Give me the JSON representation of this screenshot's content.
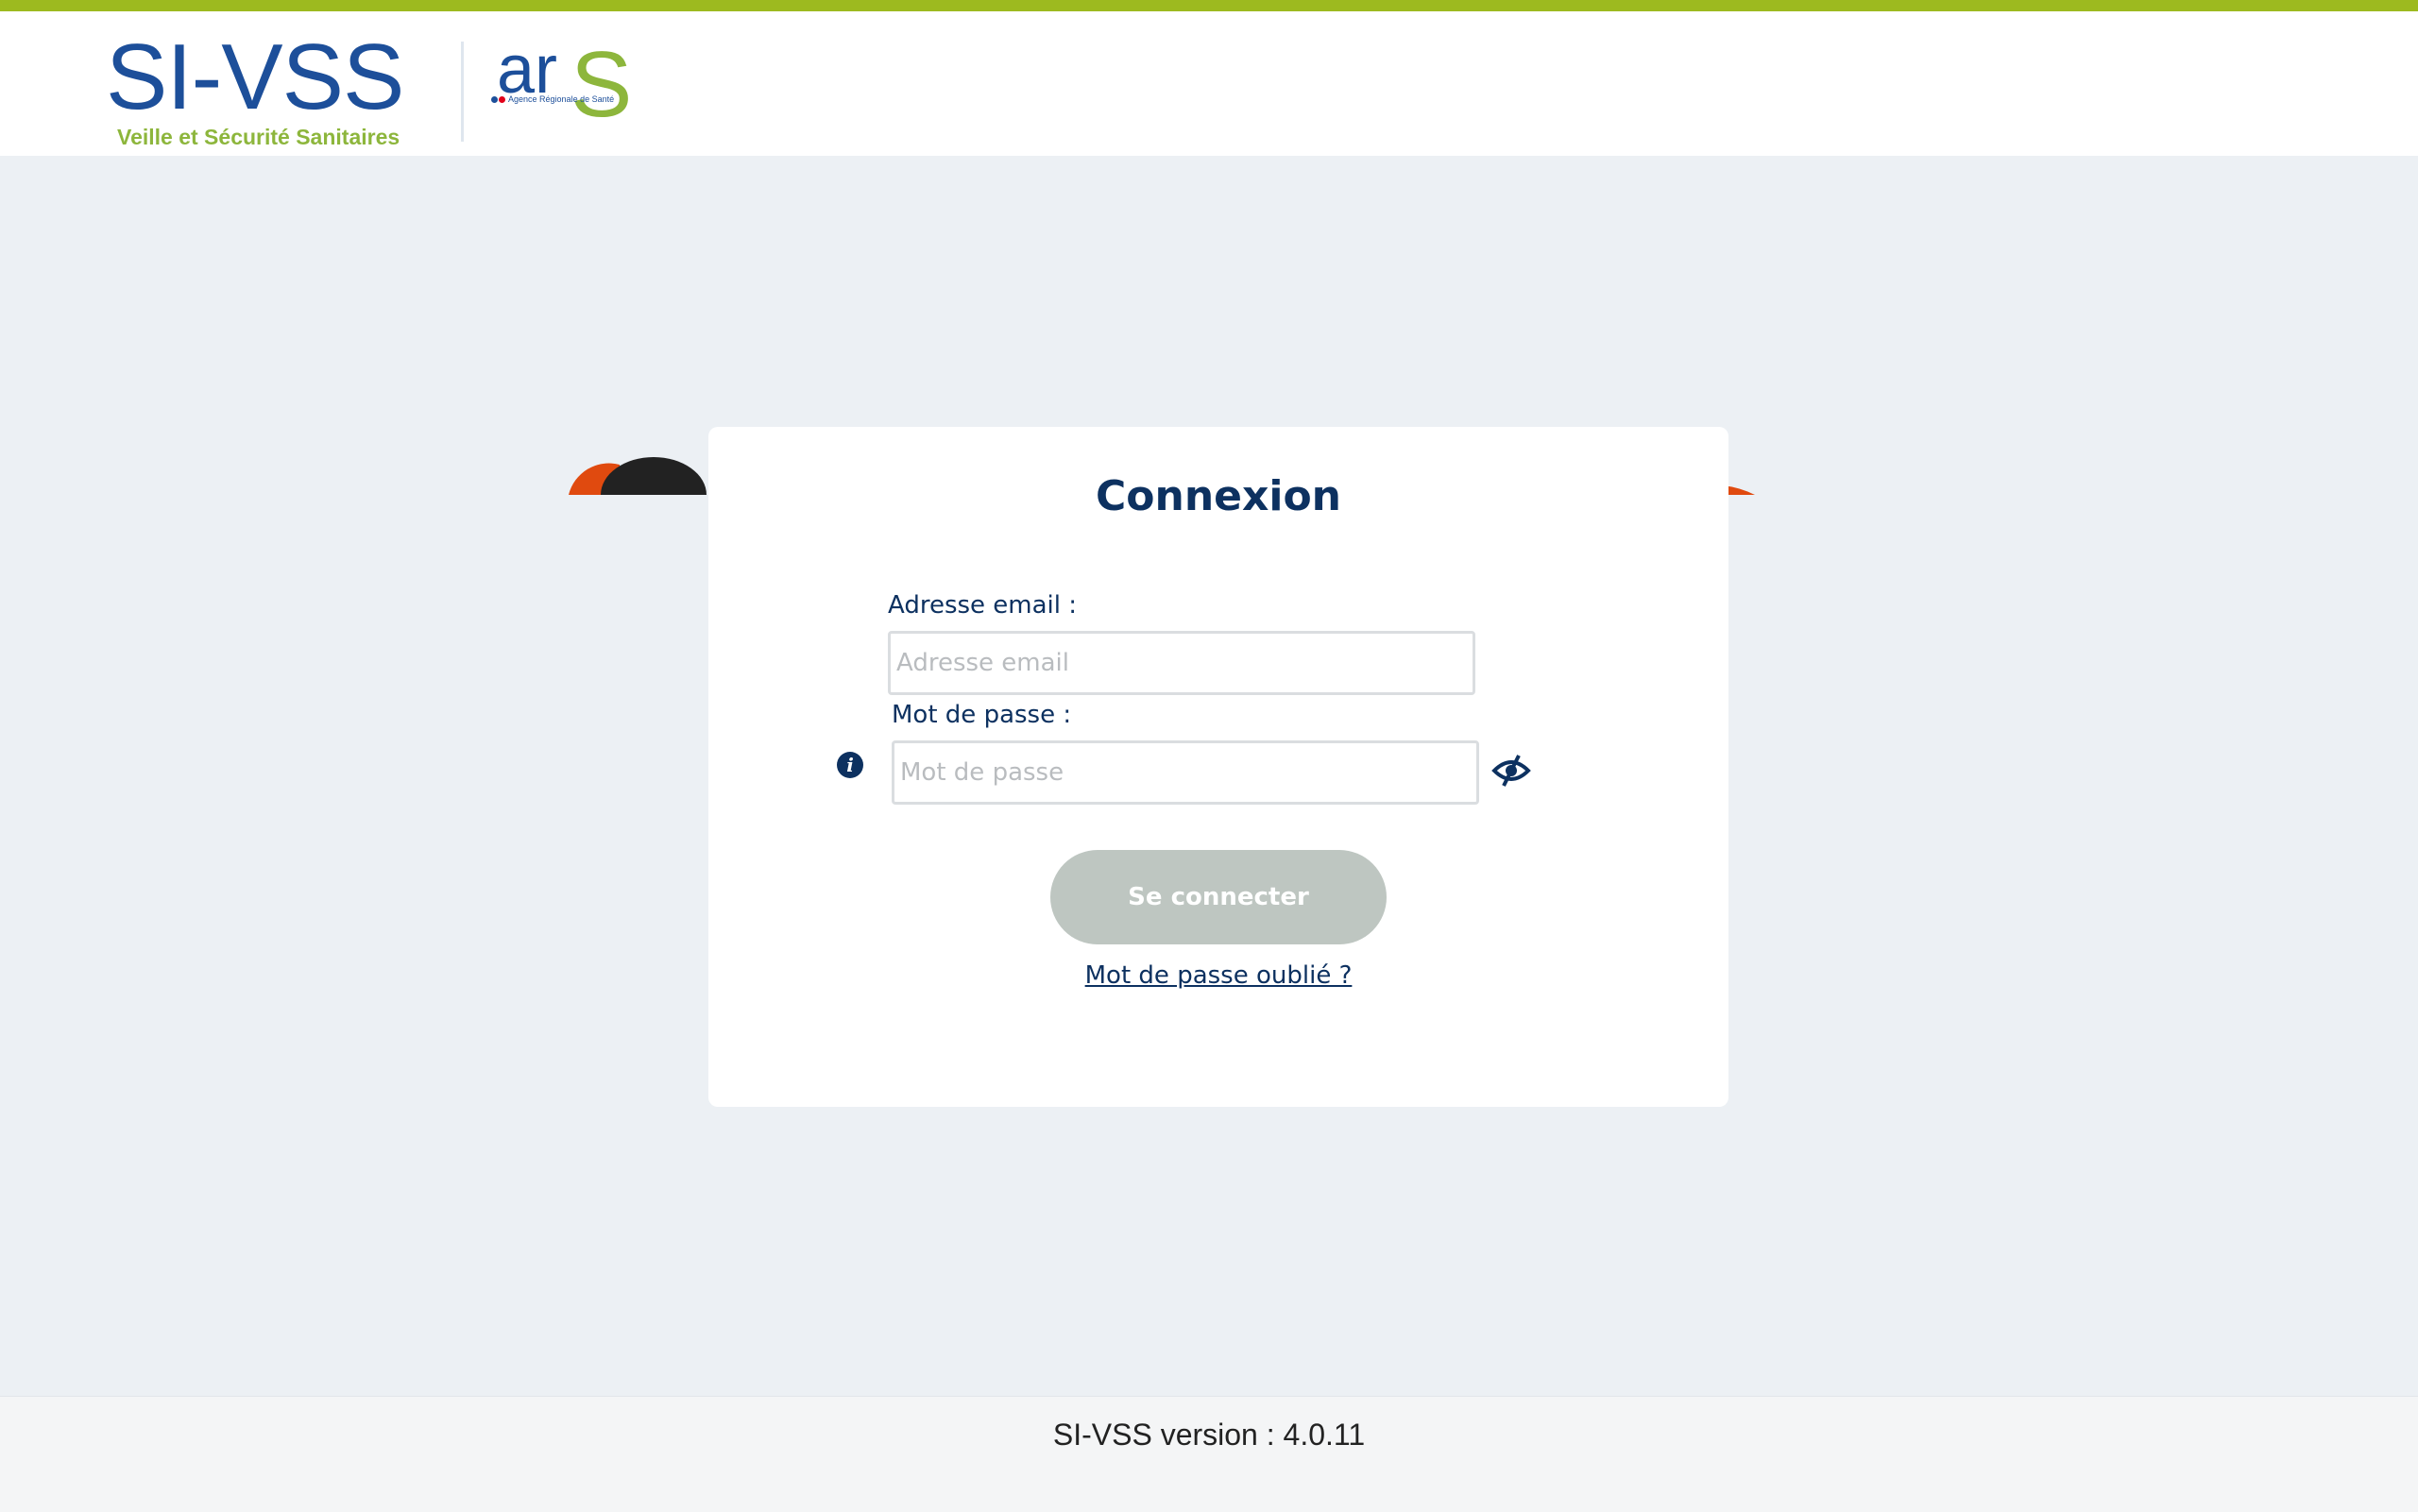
{
  "header": {
    "logo_main": "SI-VSS",
    "logo_subtitle": "Veille et Sécurité Sanitaires",
    "ars_logo": {
      "ar": "ar",
      "s": "S",
      "tagline": "Agence Régionale de Santé"
    }
  },
  "colors": {
    "top_bar": "#9dba1f",
    "brand_blue": "#1d4f9a",
    "brand_green": "#8db63c",
    "title_navy": "#0d3160",
    "button_disabled": "#bec6c1",
    "deco_orange": "#e04a0f",
    "deco_dark": "#222222"
  },
  "login": {
    "title": "Connexion",
    "email_label": "Adresse email :",
    "email_placeholder": "Adresse email",
    "email_value": "",
    "password_label": "Mot de passe :",
    "password_placeholder": "Mot de passe",
    "password_value": "",
    "submit_label": "Se connecter",
    "forgot_link": "Mot de passe oublié ?",
    "info_icon": "info-icon",
    "toggle_icon": "eye-slash-icon"
  },
  "footer": {
    "version_text": "SI-VSS version : 4.0.11"
  }
}
